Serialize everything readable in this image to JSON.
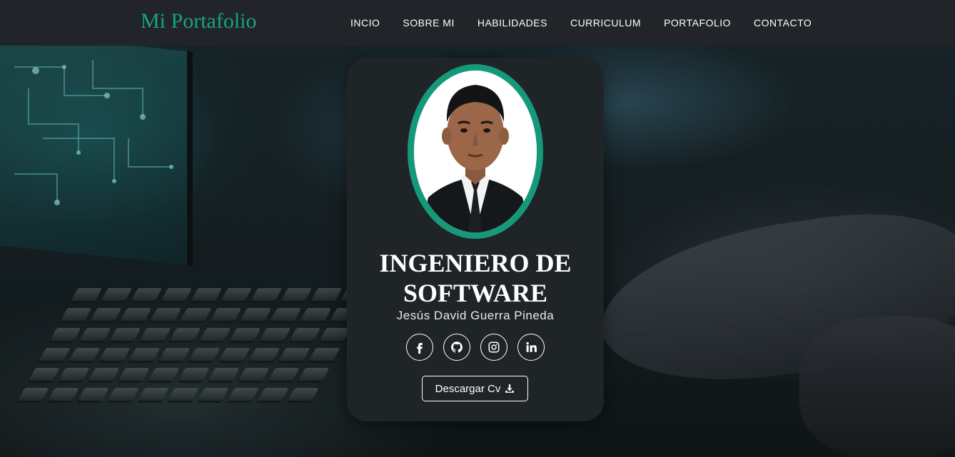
{
  "navbar": {
    "brand": "Mi Portafolio",
    "links": [
      "INCIO",
      "SOBRE MI",
      "HABILIDADES",
      "CURRICULUM",
      "PORTAFOLIO",
      "CONTACTO"
    ]
  },
  "profile": {
    "headline": "INGENIERO DE SOFTWARE",
    "name": "Jesús David Guerra Pineda",
    "socials": [
      "facebook-icon",
      "github-icon",
      "instagram-icon",
      "linkedin-icon"
    ],
    "cv_button": "Descargar Cv",
    "cv_icon": "download-icon"
  },
  "colors": {
    "brand": "#17a37e",
    "navbar_bg": "#212529",
    "card_bg": "#1f2427",
    "avatar_ring": "#16997a"
  }
}
